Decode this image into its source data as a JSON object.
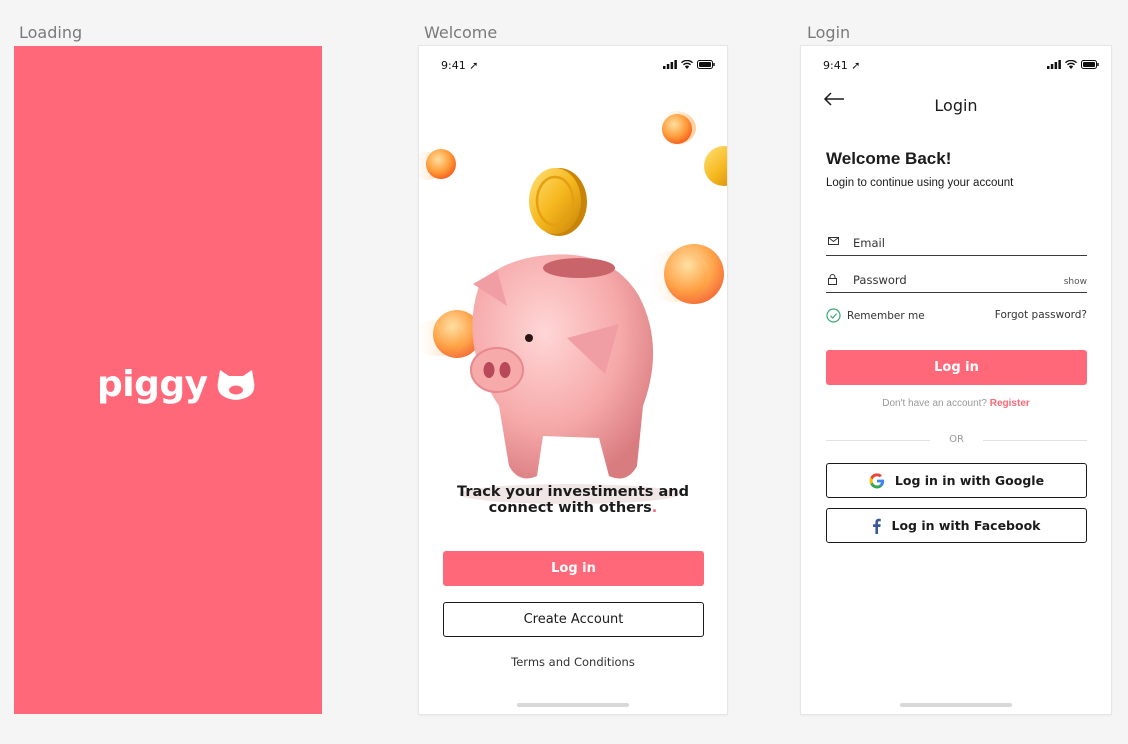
{
  "frames": {
    "loading_label": "Loading",
    "welcome_label": "Welcome",
    "login_label": "Login"
  },
  "colors": {
    "brand": "#ff6879",
    "text": "#1b1b1b",
    "muted": "#999999"
  },
  "loading": {
    "logo_text": "piggy",
    "logo_icon": "pig-face-icon"
  },
  "status_bar": {
    "time": "9:41"
  },
  "welcome": {
    "tagline_line1": "Track your investiments and",
    "tagline_line2": "connect with others",
    "tagline_dot": ".",
    "login_label": "Log in",
    "create_account_label": "Create Account",
    "terms_label": "Terms and Conditions"
  },
  "login": {
    "nav_title": "Login",
    "heading": "Welcome Back!",
    "subheading": "Login to continue using your account",
    "email_placeholder": "Email",
    "password_placeholder": "Password",
    "show_label": "show",
    "remember_label": "Remember me",
    "forgot_label": "Forgot password?",
    "login_button": "Log in",
    "no_account_text": "Don't have an account?",
    "register_label": "Register",
    "or_label": "OR",
    "google_label": "Log in in with Google",
    "facebook_label": "Log in with Facebook"
  }
}
